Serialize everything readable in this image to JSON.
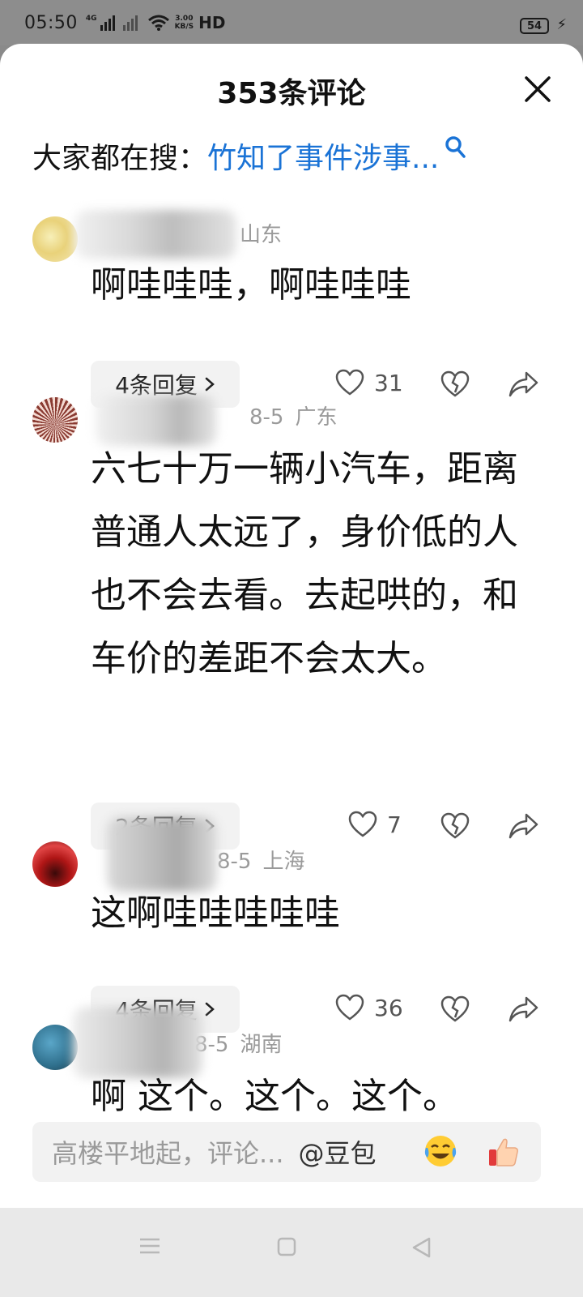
{
  "status_bar": {
    "time": "05:50",
    "network_type": "4G",
    "speed_value": "3.00",
    "speed_unit": "KB/S",
    "hd": "HD",
    "battery": "54"
  },
  "sheet": {
    "title": "353条评论",
    "trending_prefix": "大家都在搜：",
    "trending_query": "竹知了事件涉事..."
  },
  "comments": [
    {
      "date": "",
      "region": "山东",
      "text": "啊哇哇哇，啊哇哇哇",
      "replies": "4条回复",
      "likes": "31"
    },
    {
      "date": "8-5",
      "region": "广东",
      "text": "六七十万一辆小汽车，距离普通人太远了，身价低的人也不会去看。去起哄的，和车价的差距不会太大。",
      "replies": "2条回复",
      "likes": "7"
    },
    {
      "date": "8-5",
      "region": "上海",
      "text": "这啊哇哇哇哇哇",
      "replies": "4条回复",
      "likes": "36"
    },
    {
      "date": "8-5",
      "region": "湖南",
      "text": "啊 这个。这个。这个。",
      "replies": "",
      "likes": ""
    }
  ],
  "input": {
    "placeholder": "高楼平地起，评论...",
    "mention": "@豆包"
  },
  "icons": {
    "close": "close-icon",
    "search": "search-icon",
    "like": "heart-icon",
    "dislike": "broken-heart-icon",
    "share": "share-icon",
    "emoji_laugh": "laughing-crying-emoji-icon",
    "emoji_thumb": "thumbs-up-emoji-icon",
    "nav_menu": "menu-icon",
    "nav_home": "home-square-icon",
    "nav_back": "back-triangle-icon"
  },
  "colors": {
    "link_blue": "#1a73d6",
    "meta_gray": "#9a9a9a",
    "pill_bg": "#f2f2f2"
  }
}
